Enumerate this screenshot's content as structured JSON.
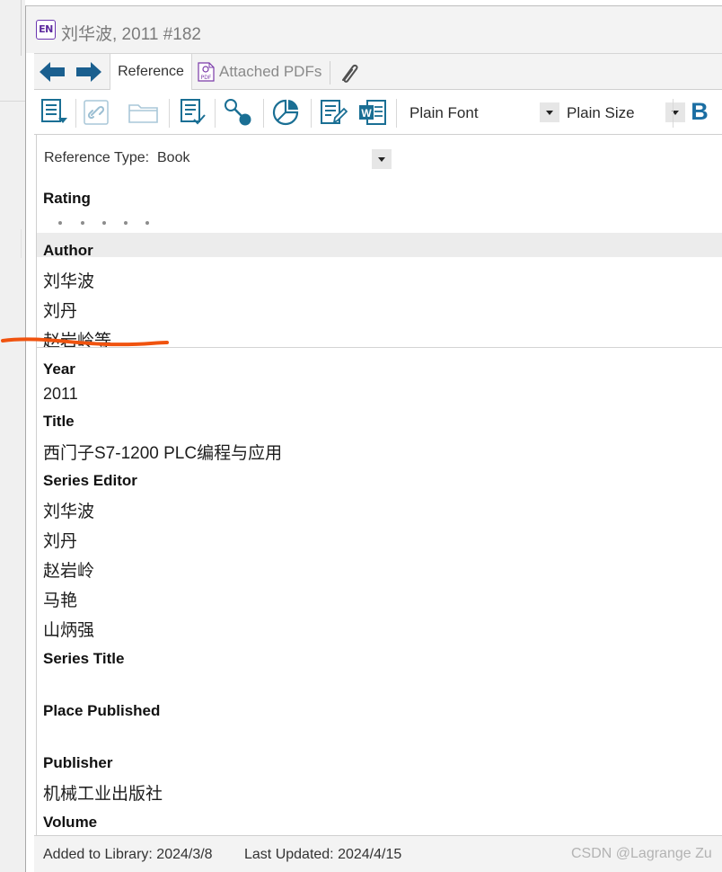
{
  "window": {
    "logo_text": "EN",
    "title": "刘华波, 2011 #182"
  },
  "tabs": {
    "reference": "Reference",
    "attached_pdfs": "Attached PDFs",
    "pdf_badge": "PDF"
  },
  "toolbar": {
    "font_value": "Plain Font",
    "size_value": "Plain Size",
    "bold_label": "B",
    "word_badge": "W",
    "icons": [
      "insert-citation-icon",
      "link-icon",
      "folder-icon",
      "format-bibliography-icon",
      "share-icon",
      "pie-chart-icon",
      "edit-reference-icon",
      "word-icon"
    ]
  },
  "reference": {
    "type_label": "Reference Type:",
    "type_value": "Book",
    "rating_label": "Rating",
    "rating_value": 0,
    "rating_max": 5,
    "author_label": "Author",
    "authors": [
      "刘华波",
      "刘丹",
      "赵岩岭等"
    ],
    "year_label": "Year",
    "year": "2011",
    "title_label": "Title",
    "title": "西门子S7-1200 PLC编程与应用",
    "series_editor_label": "Series Editor",
    "series_editors": [
      "刘华波",
      "刘丹",
      "赵岩岭",
      "马艳",
      "山炳强"
    ],
    "series_title_label": "Series Title",
    "series_title": "",
    "place_published_label": "Place Published",
    "place_published": "",
    "publisher_label": "Publisher",
    "publisher": "机械工业出版社",
    "volume_label": "Volume"
  },
  "status": {
    "added": "Added to Library: 2024/3/8",
    "updated": "Last Updated: 2024/4/15"
  },
  "watermark": "CSDN @Lagrange Zu",
  "colors": {
    "accent_blue": "#1b6ea3",
    "teal_icons": "#1a6f94",
    "annotation_orange": "#f0530f",
    "endnote_purple": "#6b35b0"
  }
}
